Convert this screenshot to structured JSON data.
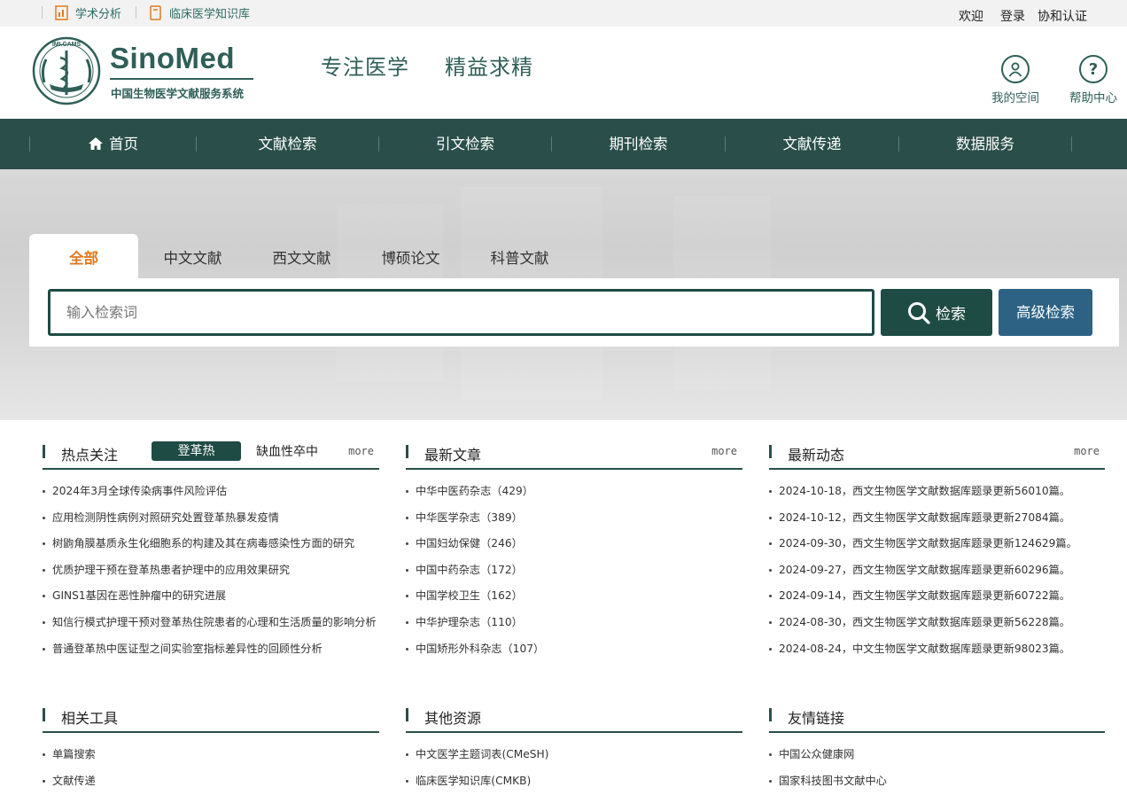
{
  "topbar": {
    "links": [
      "学术分析",
      "临床医学知识库"
    ],
    "welcome": "欢迎",
    "login": "登录",
    "auth": "协和认证"
  },
  "header": {
    "emblem_text": "IMI.CAMS",
    "brand": "SinoMed",
    "brand_sub": "中国生物医学文献服务系统",
    "slogan_1": "专注医学",
    "slogan_2": "精益求精",
    "my_space": "我的空间",
    "help": "帮助中心",
    "help_glyph": "?"
  },
  "nav": {
    "items": [
      "首页",
      "文献检索",
      "引文检索",
      "期刊检索",
      "文献传递",
      "数据服务"
    ]
  },
  "search": {
    "tabs": [
      "全部",
      "中文文献",
      "西文文献",
      "博硕论文",
      "科普文献"
    ],
    "placeholder": "输入检索词",
    "search_label": "检索",
    "advanced_label": "高级检索"
  },
  "hot": {
    "title": "热点关注",
    "tab_active": "登革热",
    "tab_other": "缺血性卒中",
    "more": "more",
    "items": [
      "2024年3月全球传染病事件风险评估",
      "应用检测阴性病例对照研究处置登革热暴发疫情",
      "树鼩角膜基质永生化细胞系的构建及其在病毒感染性方面的研究",
      "优质护理干预在登革热患者护理中的应用效果研究",
      "GINS1基因在恶性肿瘤中的研究进展",
      "知信行模式护理干预对登革热住院患者的心理和生活质量的影响分析",
      "普通登革热中医证型之间实验室指标差异性的回顾性分析"
    ]
  },
  "latest": {
    "title": "最新文章",
    "more": "more",
    "items": [
      "中华中医药杂志（429）",
      "中华医学杂志（389）",
      "中国妇幼保健（246）",
      "中国中药杂志（172）",
      "中国学校卫生（162）",
      "中华护理杂志（110）",
      "中国矫形外科杂志（107）"
    ]
  },
  "news": {
    "title": "最新动态",
    "more": "more",
    "items": [
      "2024-10-18，西文生物医学文献数据库题录更新56010篇。",
      "2024-10-12，西文生物医学文献数据库题录更新27084篇。",
      "2024-09-30，西文生物医学文献数据库题录更新124629篇。",
      "2024-09-27，西文生物医学文献数据库题录更新60296篇。",
      "2024-09-14，西文生物医学文献数据库题录更新60722篇。",
      "2024-08-30，西文生物医学文献数据库题录更新56228篇。",
      "2024-08-24，中文生物医学文献数据库题录更新98023篇。"
    ]
  },
  "tools": {
    "title": "相关工具",
    "items": [
      "单篇搜索",
      "文献传递"
    ]
  },
  "resources": {
    "title": "其他资源",
    "items": [
      "中文医学主题词表(CMeSH)",
      "临床医学知识库(CMKB)"
    ]
  },
  "links": {
    "title": "友情链接",
    "items": [
      "中国公众健康网",
      "国家科技图书文献中心"
    ]
  },
  "colors": {
    "brand_green": "#2a4f4a",
    "active_orange": "#e07a1f",
    "advanced_blue": "#2d6284"
  }
}
